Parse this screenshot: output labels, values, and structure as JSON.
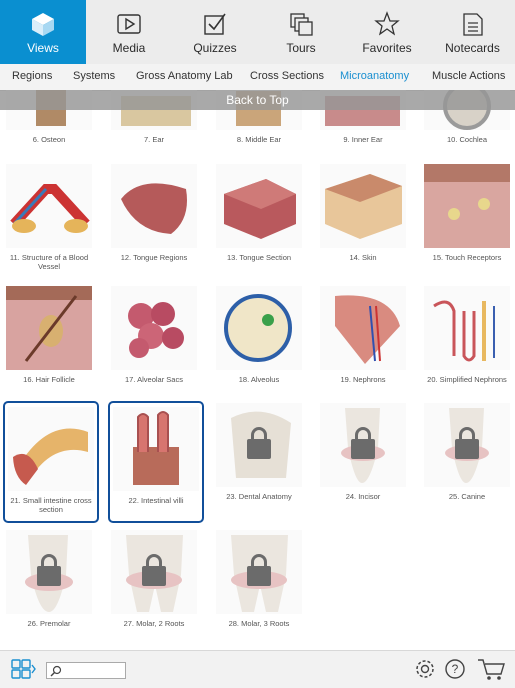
{
  "tabs": [
    {
      "label": "Views",
      "icon": "cube-icon"
    },
    {
      "label": "Media",
      "icon": "play-icon"
    },
    {
      "label": "Quizzes",
      "icon": "checkbox-icon"
    },
    {
      "label": "Tours",
      "icon": "stack-icon"
    },
    {
      "label": "Favorites",
      "icon": "star-icon"
    },
    {
      "label": "Notecards",
      "icon": "notecard-icon"
    }
  ],
  "subnav": [
    "Regions",
    "Systems",
    "Gross Anatomy Lab",
    "Cross Sections",
    "Microanatomy",
    "Muscle Actions"
  ],
  "back_to_top": "Back to Top",
  "items": [
    {
      "label": "6. Osteon"
    },
    {
      "label": "7. Ear"
    },
    {
      "label": "8. Middle Ear"
    },
    {
      "label": "9. Inner Ear"
    },
    {
      "label": "10. Cochlea"
    },
    {
      "label": "11. Structure of a Blood Vessel"
    },
    {
      "label": "12. Tongue Regions"
    },
    {
      "label": "13. Tongue Section"
    },
    {
      "label": "14. Skin"
    },
    {
      "label": "15. Touch Receptors"
    },
    {
      "label": "16. Hair Follicle"
    },
    {
      "label": "17. Alveolar Sacs"
    },
    {
      "label": "18. Alveolus"
    },
    {
      "label": "19. Nephrons"
    },
    {
      "label": "20. Simplified Nephrons"
    },
    {
      "label": "21. Small intestine cross section"
    },
    {
      "label": "22. Intestinal villi"
    },
    {
      "label": "23. Dental Anatomy"
    },
    {
      "label": "24. Incisor"
    },
    {
      "label": "25. Canine"
    },
    {
      "label": "26. Premolar"
    },
    {
      "label": "27. Molar, 2 Roots"
    },
    {
      "label": "28. Molar, 3 Roots"
    }
  ],
  "colors": {
    "accent": "#0a8fd0",
    "selected_border": "#114f9a"
  }
}
